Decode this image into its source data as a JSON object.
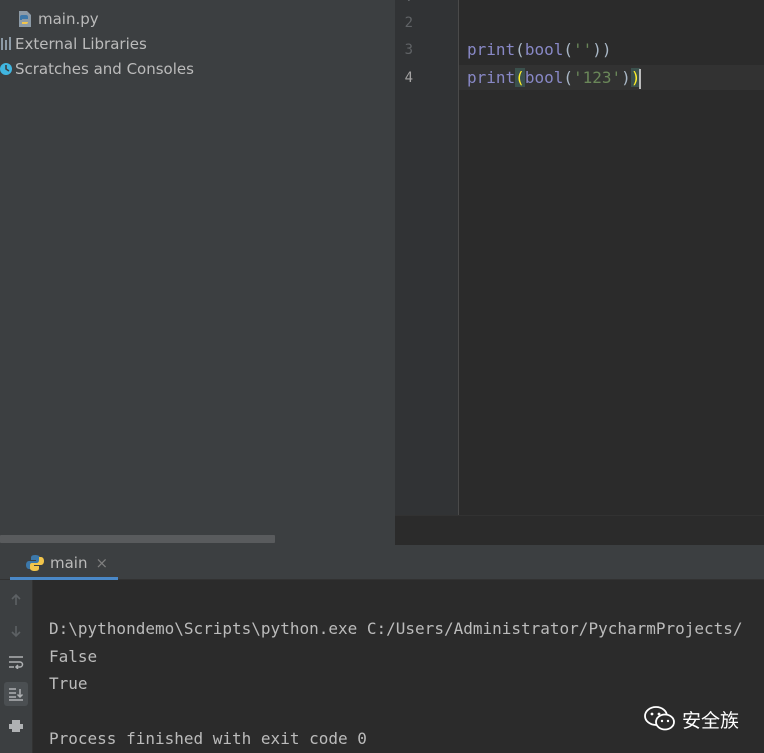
{
  "project_tree": {
    "items": [
      {
        "label": "main.py",
        "icon": "python-file-icon"
      },
      {
        "label": "External Libraries",
        "icon": "libraries-icon"
      },
      {
        "label": "Scratches and Consoles",
        "icon": "scratches-icon"
      }
    ]
  },
  "editor": {
    "line_numbers": [
      "2",
      "3",
      "4"
    ],
    "active_line": "4",
    "lines": [
      {
        "fn": "print",
        "p1": "(",
        "fn2": "bool",
        "p2": "(",
        "str": "''",
        "p3": ")",
        "p4": ")"
      },
      {
        "fn": "print",
        "p1": "(",
        "fn2": "bool",
        "p2": "(",
        "str": "'123'",
        "p3": ")",
        "p4": ")"
      }
    ]
  },
  "run": {
    "tab_label": "main",
    "close_glyph": "×",
    "toolbar": [
      {
        "name": "up-arrow-icon",
        "active": false
      },
      {
        "name": "down-arrow-icon",
        "active": false
      },
      {
        "name": "soft-wrap-icon",
        "active": false
      },
      {
        "name": "scroll-to-end-icon",
        "active": true
      },
      {
        "name": "print-icon",
        "active": false
      }
    ],
    "console_lines": [
      "D:\\pythondemo\\Scripts\\python.exe C:/Users/Administrator/PycharmProjects/",
      "False",
      "True",
      "",
      "Process finished with exit code 0"
    ]
  },
  "watermark": {
    "text": "安全族"
  },
  "colors": {
    "accent": "#4a88c7",
    "keyword_builtin": "#8888c6",
    "string": "#6a8759",
    "bracket_match": "#ffef28"
  }
}
